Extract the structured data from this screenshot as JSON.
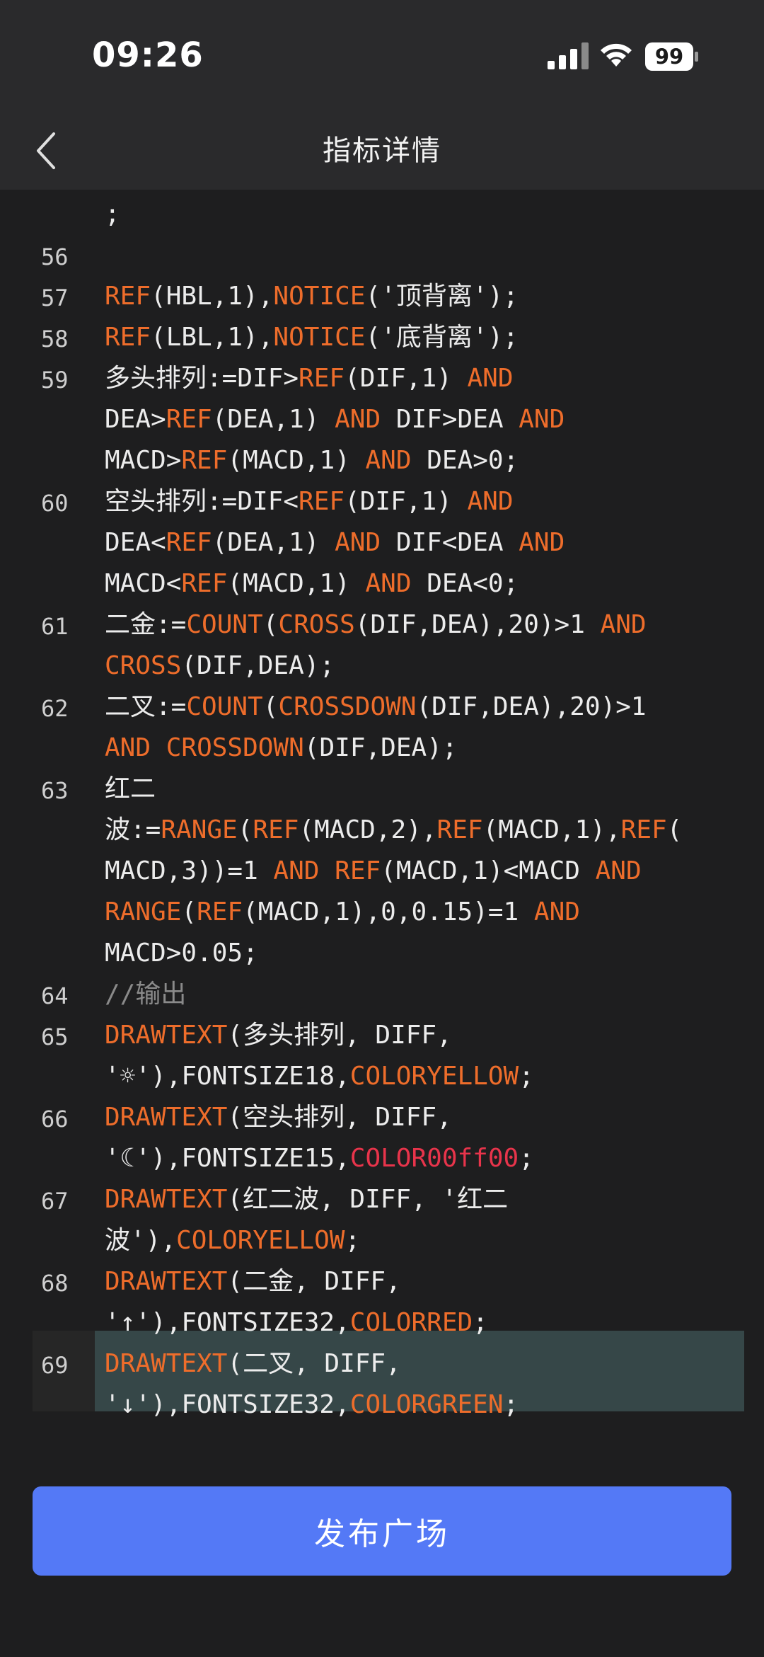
{
  "status": {
    "time": "09:26",
    "battery": "99"
  },
  "nav": {
    "title": "指标详情"
  },
  "code": {
    "lines": [
      {
        "num": "",
        "parts": [
          ";"
        ]
      },
      {
        "num": "56",
        "parts": [
          ""
        ]
      },
      {
        "num": "57",
        "parts": [
          "REF",
          "(HBL,1),",
          "NOTICE",
          "('顶背离');"
        ]
      },
      {
        "num": "58",
        "parts": [
          "REF",
          "(LBL,1),",
          "NOTICE",
          "('底背离');"
        ]
      },
      {
        "num": "59",
        "rows": [
          [
            "多头排列:=DIF>",
            "REF",
            "(DIF,1) ",
            "AND"
          ],
          [
            "DEA>",
            "REF",
            "(DEA,1) ",
            "AND",
            " DIF>DEA ",
            "AND"
          ],
          [
            "MACD>",
            "REF",
            "(MACD,1) ",
            "AND",
            " DEA>0;"
          ]
        ]
      },
      {
        "num": "60",
        "rows": [
          [
            "空头排列:=DIF<",
            "REF",
            "(DIF,1) ",
            "AND"
          ],
          [
            "DEA<",
            "REF",
            "(DEA,1) ",
            "AND",
            " DIF<DEA ",
            "AND"
          ],
          [
            "MACD<",
            "REF",
            "(MACD,1) ",
            "AND",
            " DEA<0;"
          ]
        ]
      },
      {
        "num": "61",
        "rows": [
          [
            "二金:=",
            "COUNT",
            "(",
            "CROSS",
            "(DIF,DEA),20)>1 ",
            "AND"
          ],
          [
            "CROSS",
            "(DIF,DEA);"
          ]
        ]
      },
      {
        "num": "62",
        "rows": [
          [
            "二叉:=",
            "COUNT",
            "(",
            "CROSSDOWN",
            "(DIF,DEA),20)>1"
          ],
          [
            "AND",
            " ",
            "CROSSDOWN",
            "(DIF,DEA);"
          ]
        ]
      },
      {
        "num": "63",
        "rows": [
          [
            "红二"
          ],
          [
            "波:=",
            "RANGE",
            "(",
            "REF",
            "(MACD,2),",
            "REF",
            "(MACD,1),",
            "REF",
            "("
          ],
          [
            "MACD,3))=1 ",
            "AND",
            " ",
            "REF",
            "(MACD,1)<MACD ",
            "AND"
          ],
          [
            "RANGE",
            "(",
            "REF",
            "(MACD,1),0,0.15)=1 ",
            "AND"
          ],
          [
            "MACD>0.05;"
          ]
        ]
      },
      {
        "num": "64",
        "rows": [
          [
            "//输出"
          ]
        ]
      },
      {
        "num": "65",
        "rows": [
          [
            "DRAWTEXT",
            "(多头排列, DIFF,"
          ],
          [
            "'☼'),FONTSIZE18,",
            "COLORYELLOW",
            ";"
          ]
        ]
      },
      {
        "num": "66",
        "rows": [
          [
            "DRAWTEXT",
            "(空头排列, DIFF,"
          ],
          [
            "'☾'),FONTSIZE15,",
            "COLOR00ff00",
            ";"
          ]
        ]
      },
      {
        "num": "67",
        "rows": [
          [
            "DRAWTEXT",
            "(红二波, DIFF, '红二"
          ],
          [
            "波'),",
            "COLORYELLOW",
            ";"
          ]
        ]
      },
      {
        "num": "68",
        "rows": [
          [
            "DRAWTEXT",
            "(二金, DIFF,"
          ],
          [
            "'↑'),FONTSIZE32,",
            "COLORRED",
            ";"
          ]
        ]
      },
      {
        "num": "69",
        "rows": [
          [
            "DRAWTEXT",
            "(二叉, DIFF,"
          ],
          [
            "'↓'),FONTSIZE32,",
            "COLORGREEN",
            ";"
          ]
        ]
      }
    ]
  },
  "footer": {
    "publish_label": "发布广场"
  }
}
